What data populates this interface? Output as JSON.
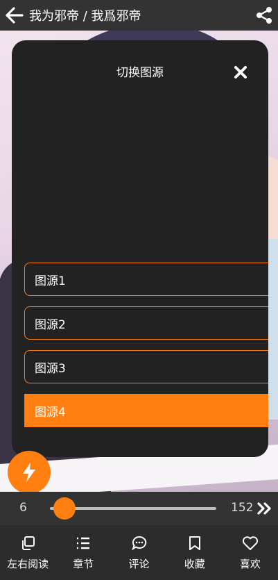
{
  "header": {
    "title": "我为邪帝 / 我爲邪帝",
    "back_icon": "arrow-left-icon",
    "share_icon": "share-icon"
  },
  "modal": {
    "title": "切换图源",
    "close_icon": "close-icon",
    "sources": [
      {
        "label": "图源1",
        "selected": false
      },
      {
        "label": "图源2",
        "selected": false
      },
      {
        "label": "图源3",
        "selected": false
      },
      {
        "label": "图源4",
        "selected": true
      }
    ]
  },
  "fab": {
    "icon": "lightning-icon"
  },
  "slider": {
    "current": "6",
    "total": "152",
    "next_icon": "double-chevron-right-icon"
  },
  "bottom_nav": {
    "items": [
      {
        "label": "左右阅读",
        "icon": "copy-pages-icon"
      },
      {
        "label": "章节",
        "icon": "list-icon"
      },
      {
        "label": "评论",
        "icon": "comment-icon"
      },
      {
        "label": "收藏",
        "icon": "bookmark-icon"
      },
      {
        "label": "喜欢",
        "icon": "heart-icon"
      }
    ]
  },
  "colors": {
    "accent": "#ff7f11",
    "bar": "#333333",
    "modal": "#222222"
  }
}
